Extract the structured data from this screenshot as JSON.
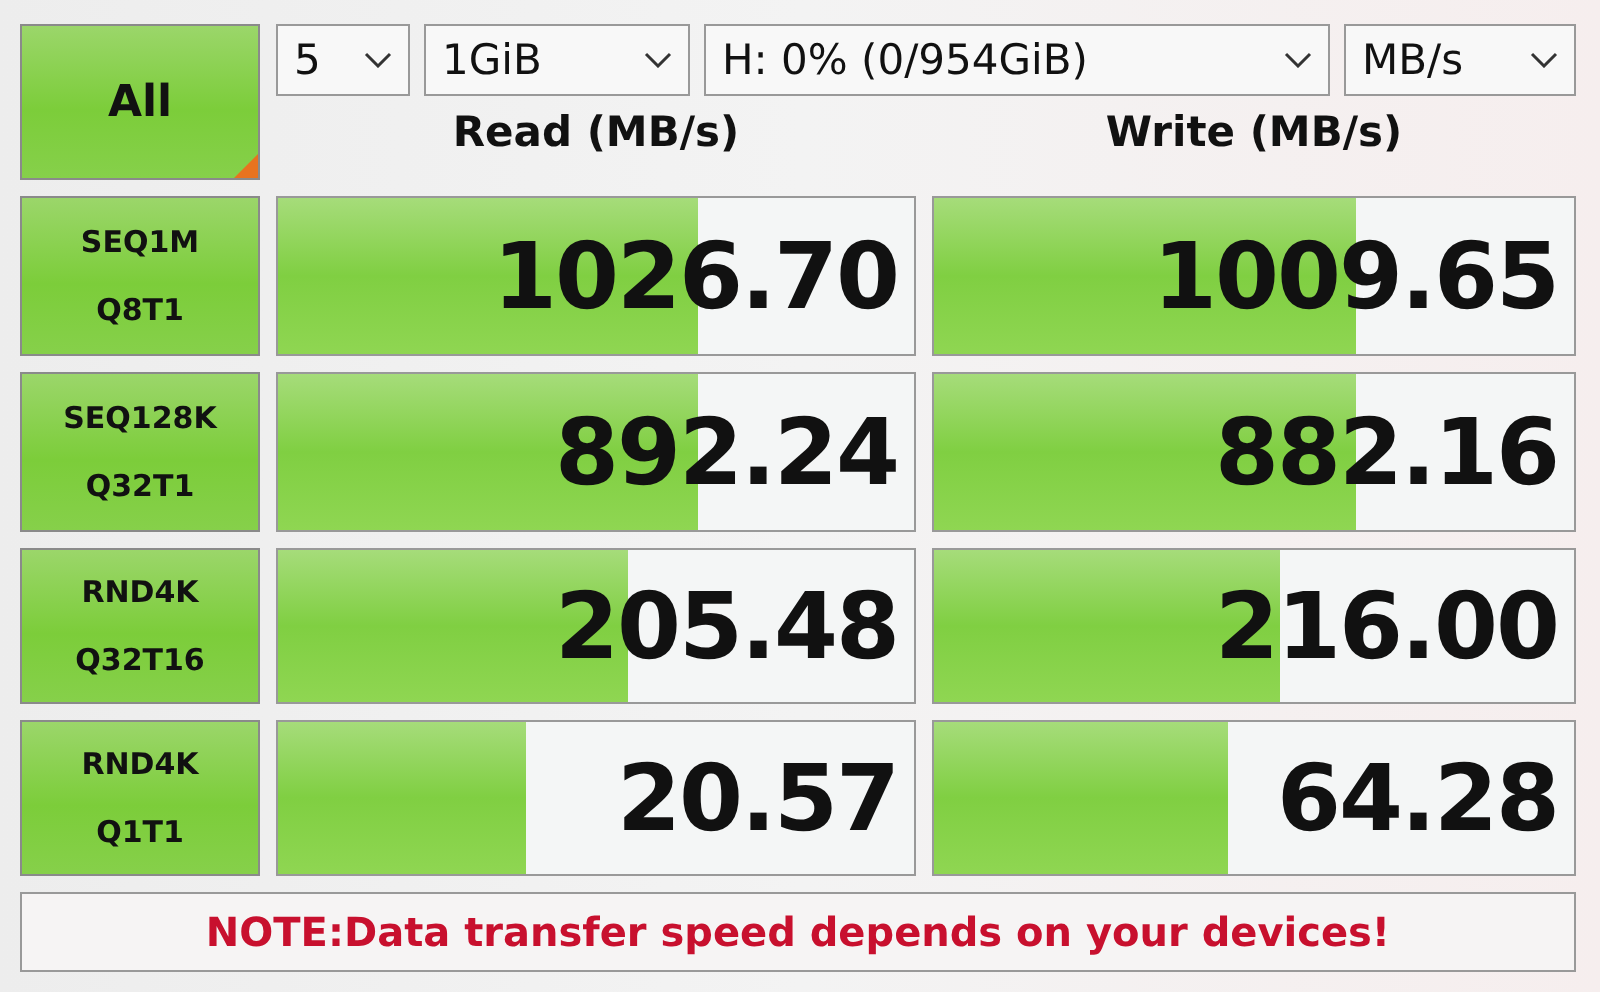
{
  "all_button": {
    "label": "All"
  },
  "selectors": [
    {
      "value": "5"
    },
    {
      "value": "1GiB"
    },
    {
      "value": "H: 0% (0/954GiB)"
    },
    {
      "value": "MB/s"
    }
  ],
  "headers": [
    "Read (MB/s)",
    "Write (MB/s)"
  ],
  "tests": [
    {
      "lines": [
        "SEQ1M",
        "Q8T1"
      ],
      "read": {
        "value": "1026.70",
        "level": 0.66
      },
      "write": {
        "value": "1009.65",
        "level": 0.66
      }
    },
    {
      "lines": [
        "SEQ128K",
        "Q32T1"
      ],
      "read": {
        "value": "892.24",
        "level": 0.66
      },
      "write": {
        "value": "882.16",
        "level": 0.66
      }
    },
    {
      "lines": [
        "RND4K",
        "Q32T16"
      ],
      "read": {
        "value": "205.48",
        "level": 0.55
      },
      "write": {
        "value": "216.00",
        "level": 0.54
      }
    },
    {
      "lines": [
        "RND4K",
        "Q1T1"
      ],
      "read": {
        "value": "20.57",
        "level": 0.39
      },
      "write": {
        "value": "64.28",
        "level": 0.46
      }
    }
  ],
  "note": "NOTE:Data transfer speed depends on your devices!"
}
